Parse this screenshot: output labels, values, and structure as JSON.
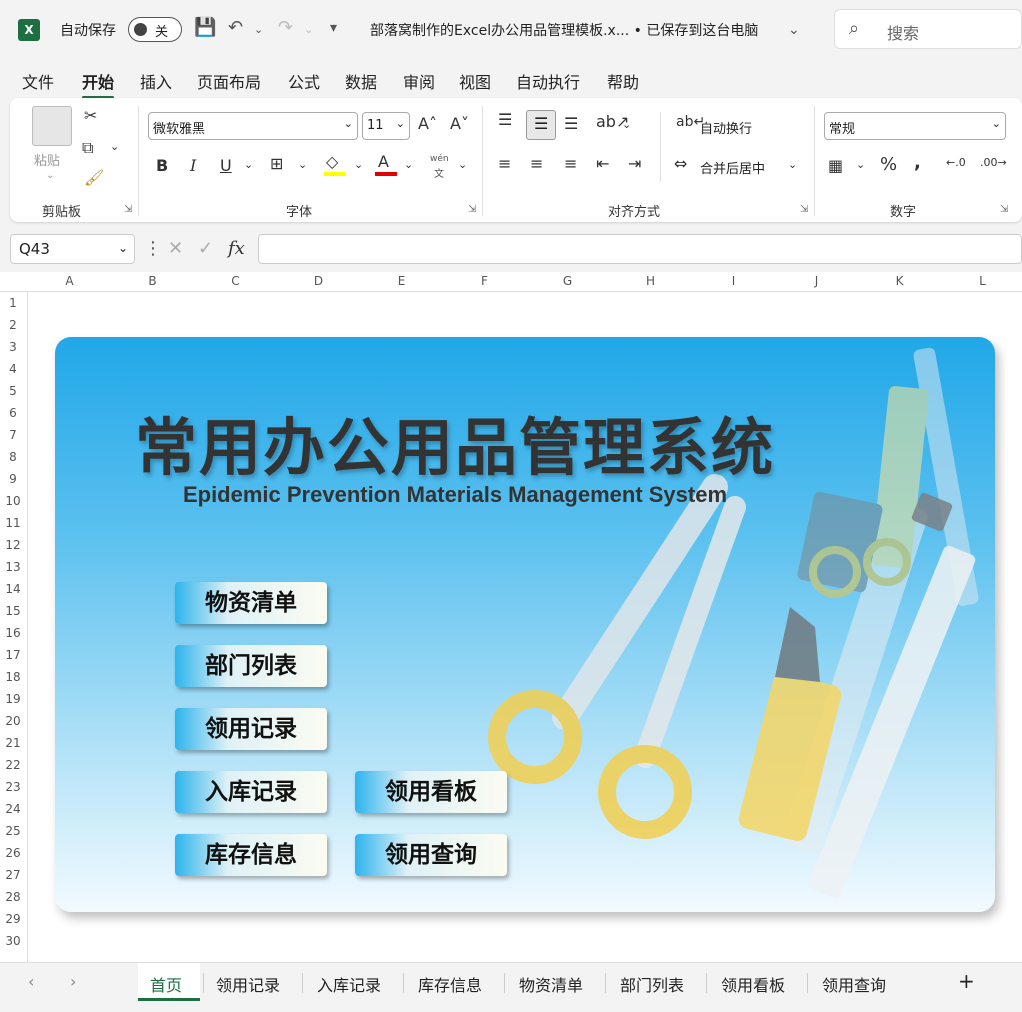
{
  "titlebar": {
    "app_logo": "X",
    "autosave_label": "自动保存",
    "autosave_state": "关",
    "doc_title": "部落窝制作的Excel办公用品管理模板.x... • 已保存到这台电脑",
    "search_placeholder": "搜索"
  },
  "menu": {
    "items": [
      "文件",
      "开始",
      "插入",
      "页面布局",
      "公式",
      "数据",
      "审阅",
      "视图",
      "自动执行",
      "帮助"
    ],
    "active": "开始"
  },
  "ribbon": {
    "clipboard": {
      "label": "剪贴板",
      "paste": "粘贴"
    },
    "font": {
      "label": "字体",
      "family": "微软雅黑",
      "size": "11",
      "phonetic_top": "wén",
      "phonetic_bottom": "文"
    },
    "alignment": {
      "label": "对齐方式",
      "wrap": "自动换行",
      "merge": "合并后居中"
    },
    "number": {
      "label": "数字",
      "format": "常规"
    },
    "colors": {
      "highlight": "#ffff00",
      "font_color": "#e00000",
      "accent": "#1d6f42"
    }
  },
  "formula_bar": {
    "name_box": "Q43",
    "fx": "fx",
    "content": ""
  },
  "columns": [
    "A",
    "B",
    "C",
    "D",
    "E",
    "F",
    "G",
    "H",
    "I",
    "J",
    "K",
    "L"
  ],
  "rows": [
    "1",
    "2",
    "3",
    "4",
    "5",
    "6",
    "7",
    "8",
    "9",
    "10",
    "11",
    "12",
    "13",
    "14",
    "15",
    "16",
    "17",
    "18",
    "19",
    "20",
    "21",
    "22",
    "23",
    "24",
    "25",
    "26",
    "27",
    "28",
    "29",
    "30"
  ],
  "dashboard": {
    "title": "常用办公用品管理系统",
    "subtitle": "Epidemic Prevention Materials Management System",
    "buttons": {
      "materials": "物资清单",
      "departments": "部门列表",
      "requisition": "领用记录",
      "stock_in": "入库记录",
      "inventory": "库存信息",
      "board": "领用看板",
      "query": "领用查询"
    }
  },
  "tabs": {
    "items": [
      "首页",
      "领用记录",
      "入库记录",
      "库存信息",
      "物资清单",
      "部门列表",
      "领用看板",
      "领用查询"
    ],
    "active": "首页",
    "add": "+",
    "prev": "‹",
    "next": "›"
  }
}
